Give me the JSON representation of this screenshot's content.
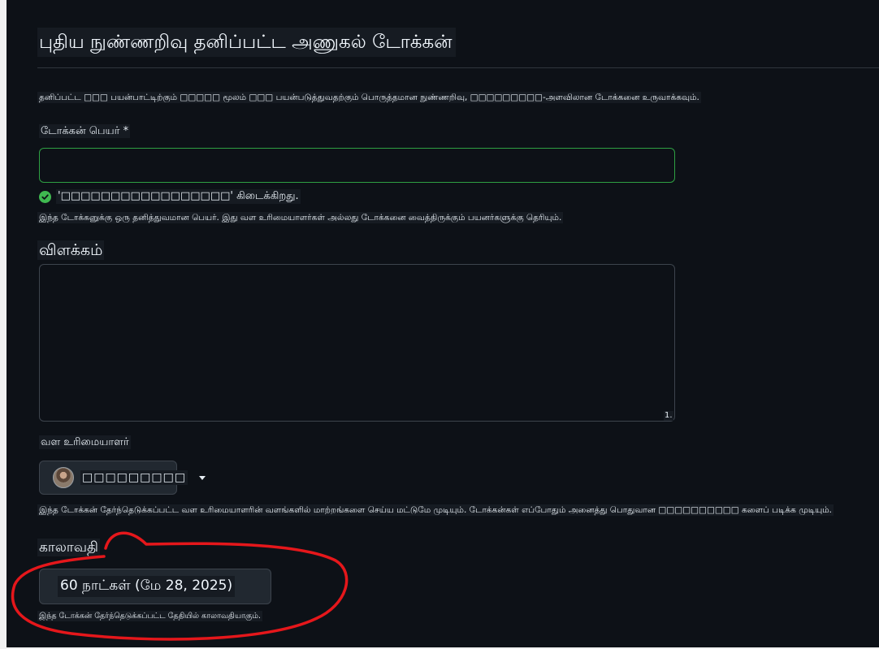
{
  "page": {
    "title": "புதிய நுண்ணறிவு தனிப்பட்ட அணுகல் டோக்கன்",
    "intro": "தனிப்பட்ட □□□ பயன்பாட்டிற்கும் □□□□□ மூலம் □□□ பயன்படுத்துவதற்கும் பொருத்தமான நுண்ணறிவு, □□□□□□□□□-அளவிலான டோக்கனை உருவாக்கவும்."
  },
  "token_name": {
    "label": "டோக்கன் பெயர் *",
    "value": "",
    "availability": "'□□□□□□□□□□□□□□□□□' கிடைக்கிறது.",
    "help": "இந்த டோக்கனுக்கு ஒரு தனித்துவமான பெயர். இது வள உரிமையாளர்கள் அல்லது டோக்கனை வைத்திருக்கும் பயனர்களுக்கு தெரியும்."
  },
  "description": {
    "heading": "விளக்கம்",
    "value": "",
    "resize_marker": "1."
  },
  "resource_owner": {
    "label": "வள உரிமையாளர்",
    "selected": "□□□□□□□□□",
    "help": "இந்த டோக்கன் தேர்ந்தெடுக்கப்பட்ட வள உரிமையாளரின் வளங்களில் மாற்றங்களை செய்ய மட்டுமே முடியும். டோக்கன்கள் எப்போதும் அனைத்து பொதுவான □□□□□□□□□□ களைப் படிக்க முடியும்."
  },
  "expiration": {
    "heading": "காலாவதி",
    "selected": "60 நாட்கள் (மே 28, 2025)",
    "help": "இந்த டோக்கன் தேர்ந்தெடுக்கப்பட்ட தேதியில் காலாவதியாகும்."
  },
  "colors": {
    "background": "#0d1117",
    "valid_border": "#2ea043",
    "success_icon": "#3fb950",
    "annotation_stroke": "#e5171b"
  },
  "icons": {
    "availability": "check-circle-icon",
    "owner_dropdown": "caret-down-icon"
  }
}
